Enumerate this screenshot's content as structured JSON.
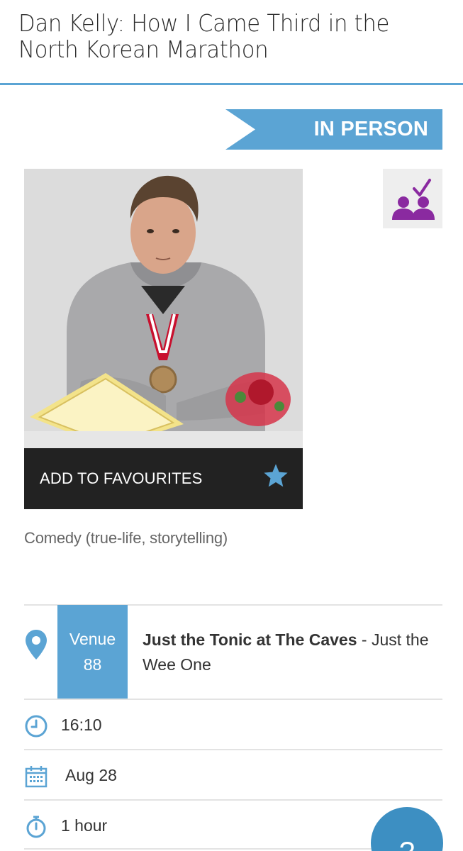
{
  "header": {
    "title": "Dan Kelly: How I Came Third in the North Korean Marathon"
  },
  "banner": {
    "label": "IN PERSON",
    "color": "#5ba4d4"
  },
  "accessibility": {
    "icon": "audience-check-icon",
    "color": "#8a2aa0"
  },
  "photo": {
    "description_icon": "show-photo"
  },
  "favourites": {
    "label": "ADD TO FAVOURITES",
    "icon": "star-icon"
  },
  "genre": "Comedy (true-life, storytelling)",
  "venue": {
    "label": "Venue",
    "number": "88",
    "name": "Just the Tonic at The Caves",
    "separator": " - ",
    "room": "Just the Wee One"
  },
  "time": "16:10",
  "date": "Aug 28",
  "duration": "1 hour",
  "help": {
    "label": "?"
  },
  "colors": {
    "accent": "#5ba4d4",
    "dark": "#222222",
    "purple": "#8a2aa0"
  }
}
